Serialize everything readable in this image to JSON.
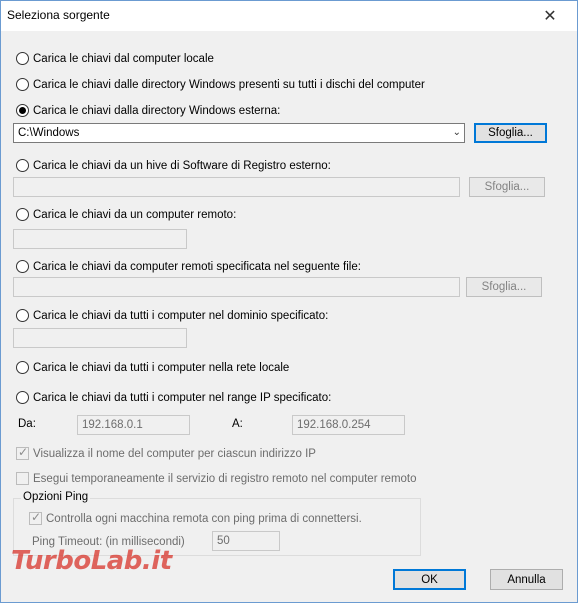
{
  "window": {
    "title": "Seleziona sorgente",
    "close_glyph": "✕"
  },
  "options": {
    "local": "Carica le chiavi dal computer locale",
    "all_disks": "Carica le chiavi dalle directory Windows presenti su tutti i dischi del computer",
    "external_dir": "Carica le chiavi dalla directory Windows esterna:",
    "external_hive": "Carica le chiavi da un hive di Software di Registro esterno:",
    "remote": "Carica le chiavi da un computer remoto:",
    "remote_file": "Carica le chiavi da computer remoti specificata nel seguente file:",
    "domain": "Carica le chiavi da tutti i computer nel dominio specificato:",
    "lan": "Carica le chiavi da tutti i computer nella rete locale",
    "ip_range": "Carica le chiavi da tutti i computer nel range IP specificato:"
  },
  "selected_option": "external_dir",
  "external_dir": {
    "value": "C:\\Windows",
    "browse_label": "Sfoglia..."
  },
  "external_hive": {
    "value": "",
    "browse_label": "Sfoglia..."
  },
  "remote": {
    "value": ""
  },
  "remote_file": {
    "value": "",
    "browse_label": "Sfoglia..."
  },
  "domain": {
    "value": ""
  },
  "ip_range": {
    "from_label": "Da:",
    "from_value": "192.168.0.1",
    "to_label": "A:",
    "to_value": "192.168.0.254"
  },
  "checks": {
    "show_name": {
      "label": "Visualizza il nome del computer per ciascun indirizzo IP",
      "checked": true,
      "enabled": false
    },
    "remote_service": {
      "label": "Esegui temporaneamente il servizio di registro remoto nel computer remoto",
      "checked": false,
      "enabled": false
    }
  },
  "ping": {
    "group_title": "Opzioni Ping",
    "check_label": "Controlla ogni macchina remota con ping prima di connettersi.",
    "timeout_label": "Ping Timeout: (in millisecondi)",
    "timeout_value": "50"
  },
  "buttons": {
    "ok": "OK",
    "cancel": "Annulla"
  },
  "watermark": "TurboLab.it"
}
